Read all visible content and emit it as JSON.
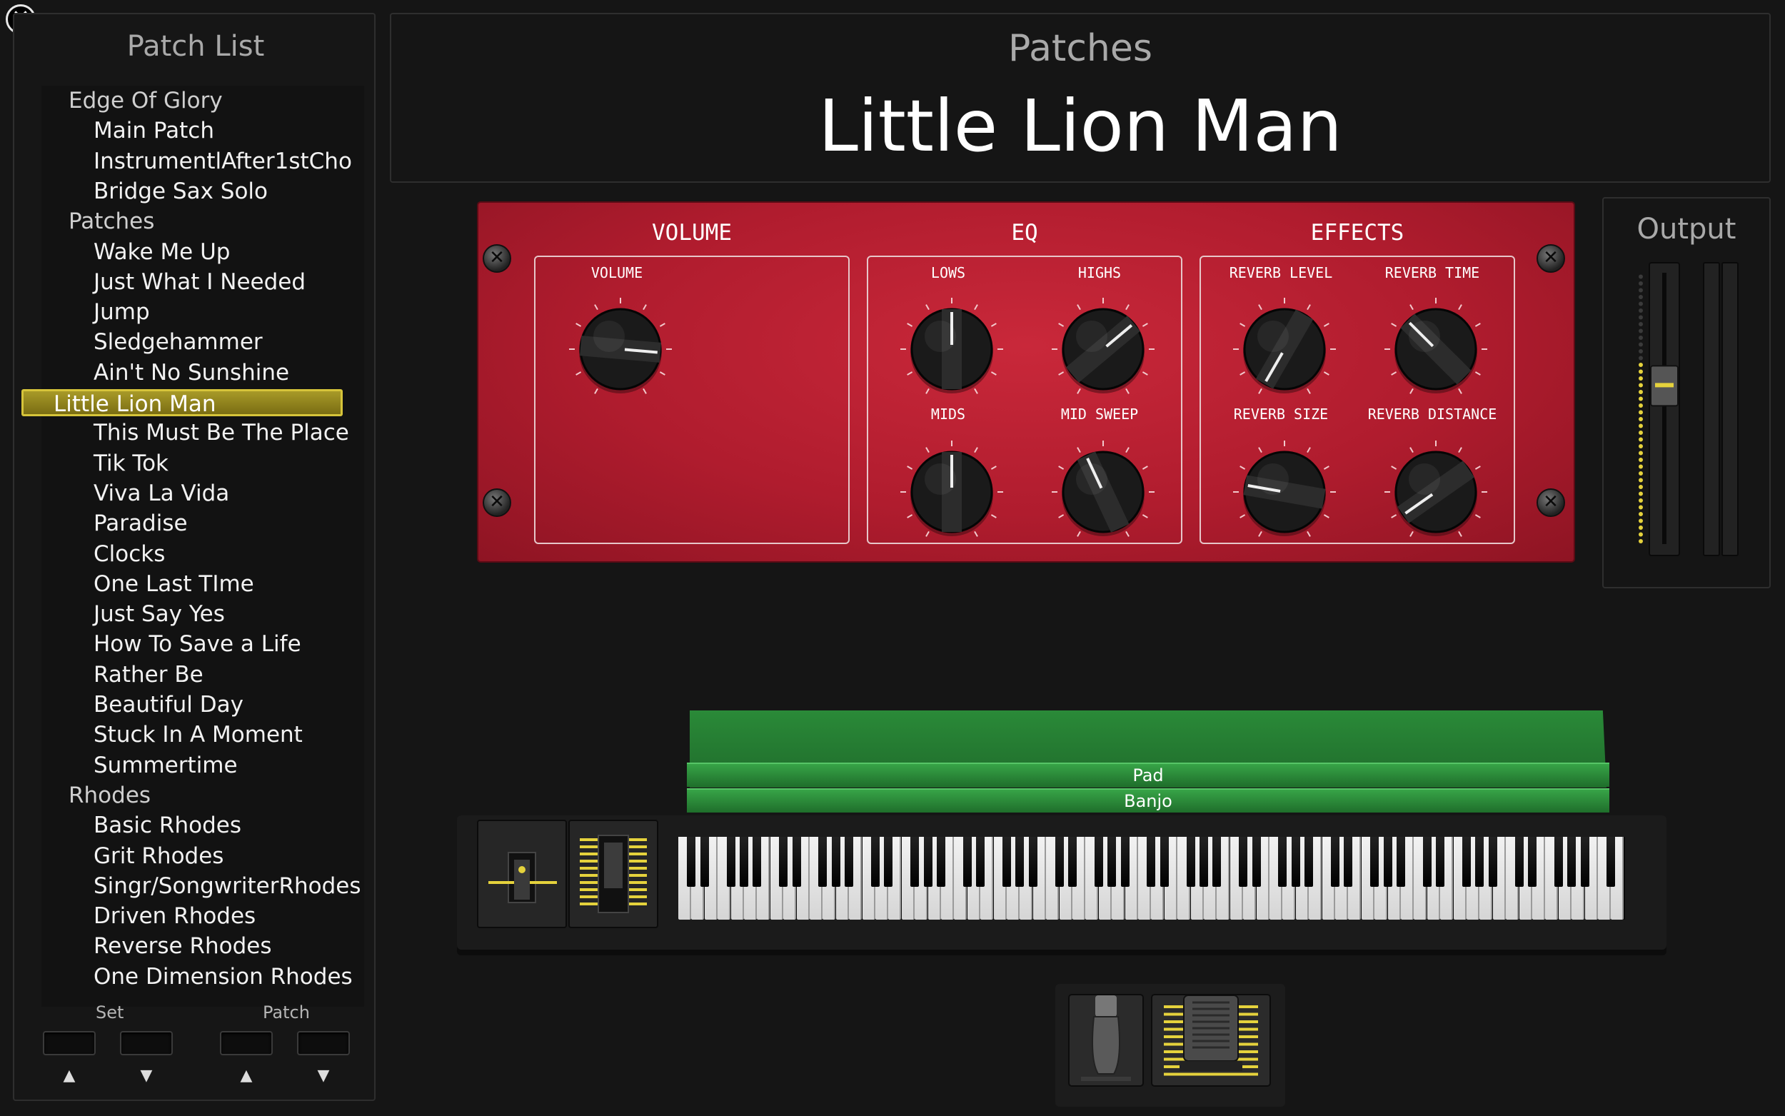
{
  "close": {
    "icon": "close-icon",
    "glyph": "✕"
  },
  "patch_list": {
    "title": "Patch List",
    "items": [
      {
        "label": "Edge Of Glory",
        "kind": "group"
      },
      {
        "label": "Main Patch",
        "kind": "patch"
      },
      {
        "label": "InstrumentlAfter1stCho",
        "kind": "patch"
      },
      {
        "label": "Bridge Sax Solo",
        "kind": "patch"
      },
      {
        "label": "Patches",
        "kind": "group"
      },
      {
        "label": "Wake Me Up",
        "kind": "patch"
      },
      {
        "label": "Just What I Needed",
        "kind": "patch"
      },
      {
        "label": "Jump",
        "kind": "patch"
      },
      {
        "label": "Sledgehammer",
        "kind": "patch"
      },
      {
        "label": "Ain't No Sunshine",
        "kind": "patch"
      },
      {
        "label": "Little Lion Man",
        "kind": "patch",
        "selected": true
      },
      {
        "label": "This Must Be The Place",
        "kind": "patch"
      },
      {
        "label": "Tik Tok",
        "kind": "patch"
      },
      {
        "label": "Viva La Vida",
        "kind": "patch"
      },
      {
        "label": "Paradise",
        "kind": "patch"
      },
      {
        "label": "Clocks",
        "kind": "patch"
      },
      {
        "label": "One Last TIme",
        "kind": "patch"
      },
      {
        "label": "Just Say Yes",
        "kind": "patch"
      },
      {
        "label": "How To Save a Life",
        "kind": "patch"
      },
      {
        "label": "Rather Be",
        "kind": "patch"
      },
      {
        "label": "Beautiful Day",
        "kind": "patch"
      },
      {
        "label": "Stuck In A Moment",
        "kind": "patch"
      },
      {
        "label": "Summertime",
        "kind": "patch"
      },
      {
        "label": "Rhodes",
        "kind": "group"
      },
      {
        "label": "Basic Rhodes",
        "kind": "patch"
      },
      {
        "label": "Grit Rhodes",
        "kind": "patch"
      },
      {
        "label": "Singr/SongwriterRhodes",
        "kind": "patch"
      },
      {
        "label": "Driven Rhodes",
        "kind": "patch"
      },
      {
        "label": "Reverse Rhodes",
        "kind": "patch"
      },
      {
        "label": "One Dimension Rhodes",
        "kind": "patch"
      }
    ],
    "nav": {
      "set_label": "Set",
      "patch_label": "Patch",
      "up_glyph": "▲",
      "down_glyph": "▼"
    }
  },
  "header": {
    "section": "Patches",
    "title": "Little Lion Man"
  },
  "rack": {
    "screw_glyph": "✕",
    "sections": [
      {
        "title": "VOLUME",
        "knobs": [
          {
            "label": "VOLUME",
            "angle": 95
          }
        ]
      },
      {
        "title": "EQ",
        "knobs": [
          {
            "label": "LOWS",
            "angle": 0
          },
          {
            "label": "HIGHS",
            "angle": 50
          },
          {
            "label": "MIDS",
            "angle": 0
          },
          {
            "label": "MID SWEEP",
            "angle": -25
          }
        ]
      },
      {
        "title": "EFFECTS",
        "knobs": [
          {
            "label": "REVERB LEVEL",
            "angle": -150
          },
          {
            "label": "REVERB TIME",
            "angle": -45
          },
          {
            "label": "REVERB SIZE",
            "angle": -80
          },
          {
            "label": "REVERB DISTANCE",
            "angle": -125
          }
        ]
      }
    ]
  },
  "output": {
    "title": "Output",
    "fader_level": 0.68
  },
  "keyboard": {
    "layers": [
      "Pad",
      "Banjo"
    ],
    "accent_color": "#e5d23c",
    "layer_color": "#2f9a3f"
  }
}
